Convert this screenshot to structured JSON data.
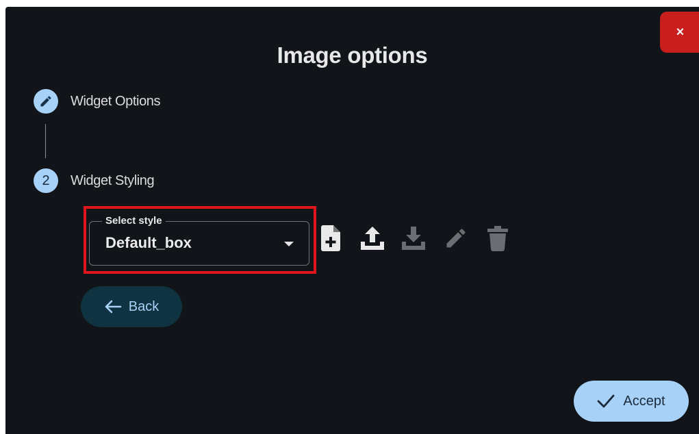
{
  "dialog": {
    "title": "Image options",
    "close_label": "×"
  },
  "steps": [
    {
      "icon": "pencil-icon",
      "label": "Widget Options"
    },
    {
      "number": "2",
      "label": "Widget Styling"
    }
  ],
  "style_select": {
    "legend": "Select style",
    "value": "Default_box"
  },
  "toolbar": [
    {
      "icon": "new-file-icon",
      "enabled": true
    },
    {
      "icon": "upload-icon",
      "enabled": true
    },
    {
      "icon": "download-icon",
      "enabled": false
    },
    {
      "icon": "edit-icon",
      "enabled": false
    },
    {
      "icon": "delete-icon",
      "enabled": false
    }
  ],
  "buttons": {
    "back_label": "Back",
    "accept_label": "Accept"
  },
  "colors": {
    "background": "#111418",
    "accent": "#a8d1f8",
    "close": "#c81e1e",
    "highlight": "#e0141c"
  }
}
